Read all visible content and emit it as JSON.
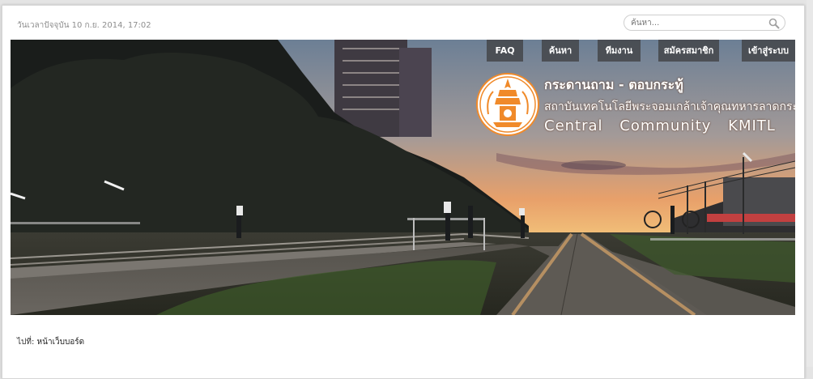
{
  "header": {
    "datetime": "วันเวลาปัจจุบัน 10 ก.ย. 2014, 17:02",
    "search_placeholder": "ค้นหา..."
  },
  "nav": {
    "items": [
      {
        "label": "FAQ"
      },
      {
        "label": "ค้นหา"
      },
      {
        "label": "ทีมงาน"
      },
      {
        "label": "สมัครสมาชิก"
      },
      {
        "label": "เข้าสู่ระบบ"
      }
    ]
  },
  "banner": {
    "title_th": "กระดานถาม - ตอบกระทู้",
    "subtitle_th": "สถาบันเทคโนโลยีพระจอมเกล้าเจ้าคุณทหารลาดกระบัง",
    "title_en": "Central Community KMITL"
  },
  "breadcrumb": {
    "prefix": "ไปที่:",
    "link": "หน้าเว็บบอร์ด"
  },
  "colors": {
    "accent_orange": "#f08a2a",
    "nav_bg": "#46484c"
  }
}
